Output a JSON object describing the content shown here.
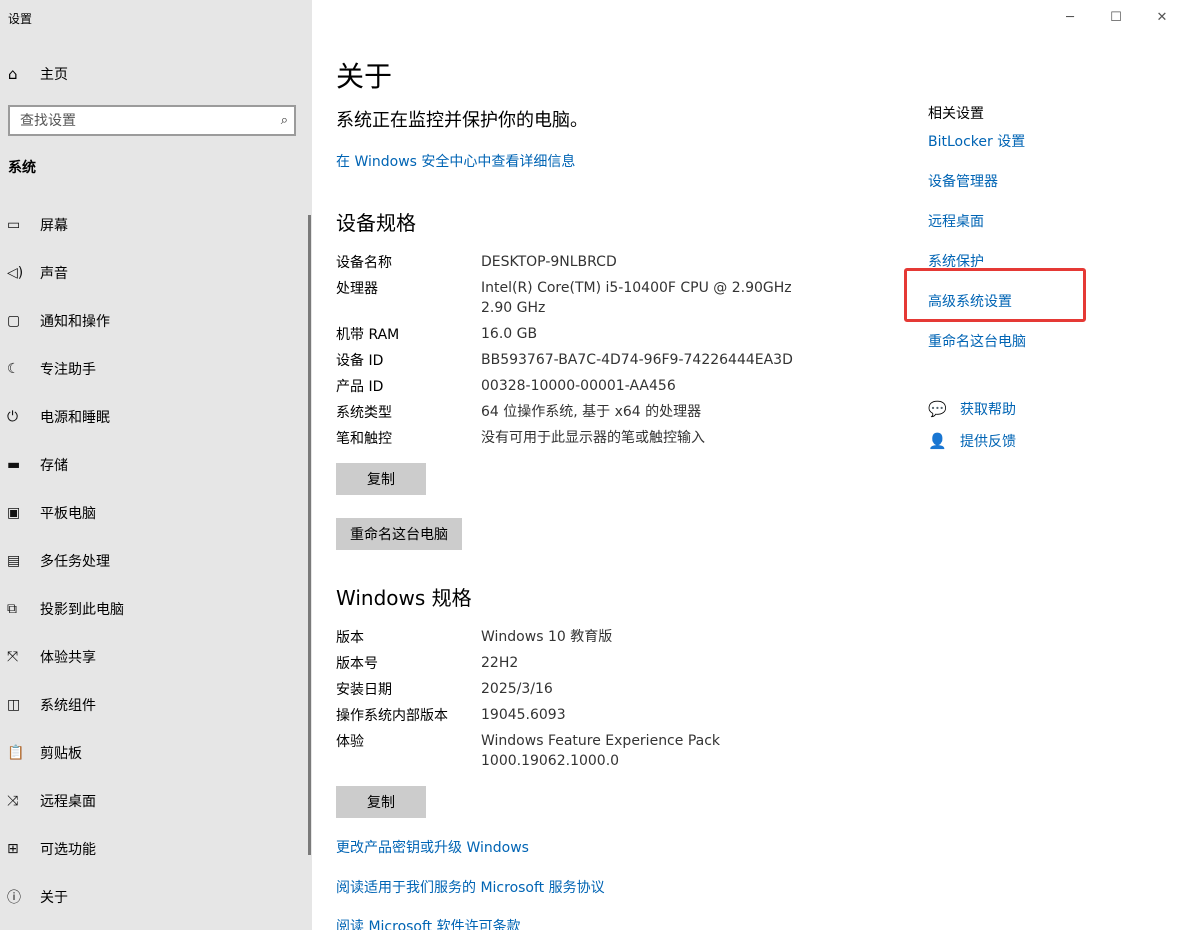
{
  "window": {
    "title": "设置",
    "min_icon": "minimize-icon",
    "max_icon": "maximize-icon",
    "close_icon": "close-icon"
  },
  "sidebar": {
    "home": {
      "label": "主页",
      "icon": "home-icon"
    },
    "search": {
      "placeholder": "查找设置",
      "icon": "search-icon"
    },
    "section": "系统",
    "items": [
      {
        "label": "屏幕",
        "icon": "display-icon"
      },
      {
        "label": "声音",
        "icon": "sound-icon"
      },
      {
        "label": "通知和操作",
        "icon": "notification-icon"
      },
      {
        "label": "专注助手",
        "icon": "moon-icon"
      },
      {
        "label": "电源和睡眠",
        "icon": "power-icon"
      },
      {
        "label": "存储",
        "icon": "storage-icon"
      },
      {
        "label": "平板电脑",
        "icon": "tablet-icon"
      },
      {
        "label": "多任务处理",
        "icon": "multitask-icon"
      },
      {
        "label": "投影到此电脑",
        "icon": "project-icon"
      },
      {
        "label": "体验共享",
        "icon": "share-icon"
      },
      {
        "label": "系统组件",
        "icon": "components-icon"
      },
      {
        "label": "剪贴板",
        "icon": "clipboard-icon"
      },
      {
        "label": "远程桌面",
        "icon": "remote-desktop-icon"
      },
      {
        "label": "可选功能",
        "icon": "optional-features-icon"
      },
      {
        "label": "关于",
        "icon": "info-icon"
      }
    ]
  },
  "main": {
    "title": "关于",
    "protect_text": "系统正在监控并保护你的电脑。",
    "security_link": "在 Windows 安全中心中查看详细信息",
    "device_specs": {
      "heading": "设备规格",
      "rows": [
        {
          "k": "设备名称",
          "v": "DESKTOP-9NLBRCD"
        },
        {
          "k": "处理器",
          "v": "Intel(R) Core(TM) i5-10400F CPU @ 2.90GHz",
          "v2": "2.90 GHz"
        },
        {
          "k": "机带 RAM",
          "v": "16.0 GB"
        },
        {
          "k": "设备 ID",
          "v": "BB593767-BA7C-4D74-96F9-74226444EA3D"
        },
        {
          "k": "产品 ID",
          "v": "00328-10000-00001-AA456"
        },
        {
          "k": "系统类型",
          "v": "64 位操作系统, 基于 x64 的处理器"
        },
        {
          "k": "笔和触控",
          "v": "没有可用于此显示器的笔或触控输入"
        }
      ],
      "copy_button": "复制",
      "rename_button": "重命名这台电脑"
    },
    "windows_specs": {
      "heading": "Windows 规格",
      "rows": [
        {
          "k": "版本",
          "v": "Windows 10 教育版"
        },
        {
          "k": "版本号",
          "v": "22H2"
        },
        {
          "k": "安装日期",
          "v": "2025/3/16"
        },
        {
          "k": "操作系统内部版本",
          "v": "19045.6093"
        },
        {
          "k": "体验",
          "v": "Windows Feature Experience Pack",
          "v2": "1000.19062.1000.0"
        }
      ],
      "copy_button": "复制"
    },
    "bottom_links": [
      "更改产品密钥或升级 Windows",
      "阅读适用于我们服务的 Microsoft 服务协议",
      "阅读 Microsoft 软件许可条款"
    ]
  },
  "related": {
    "title": "相关设置",
    "links": [
      "BitLocker 设置",
      "设备管理器",
      "远程桌面",
      "系统保护",
      "高级系统设置",
      "重命名这台电脑"
    ],
    "help": {
      "label": "获取帮助",
      "icon": "help-chat-icon"
    },
    "feedback": {
      "label": "提供反馈",
      "icon": "feedback-icon"
    },
    "highlight_color": "#e53935",
    "link_color": "#0064b4"
  }
}
